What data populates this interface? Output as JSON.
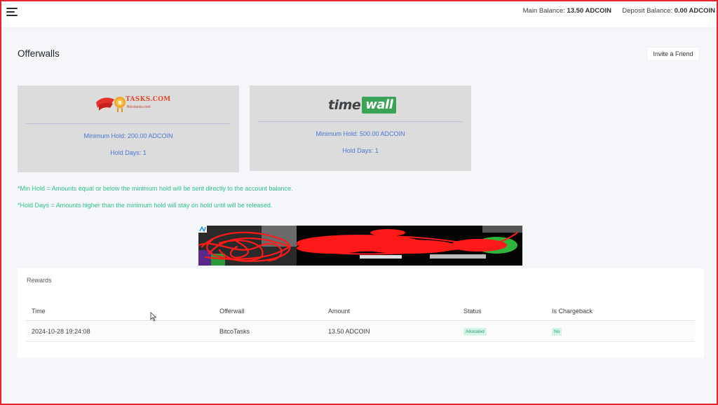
{
  "header": {
    "main_balance_label": "Main Balance:",
    "main_balance_value": "13.50 ADCOIN",
    "deposit_balance_label": "Deposit Balance:",
    "deposit_balance_value": "0.00 ADCOIN"
  },
  "page": {
    "title": "Offerwalls",
    "invite_button": "Invite a Friend"
  },
  "offerwalls": [
    {
      "logo_text": "TASKS.COM",
      "logo_subtext": "Bitcotasks.com",
      "min_hold": "Minimum Hold: 200.00 ADCOIN",
      "hold_days": "Hold Days: 1"
    },
    {
      "logo_text_1": "time",
      "logo_text_2": "wall",
      "min_hold": "Minimum Hold: 500.00 ADCOIN",
      "hold_days": "Hold Days: 1"
    }
  ],
  "notes": [
    "*Min Hold = Amounts equal or below the minimum hold will be sent directly to the account balance.",
    "*Hold Days = Amounts higher than the minimum hold will stay on hold until will be released."
  ],
  "rewards": {
    "title": "Rewards",
    "columns": [
      "Time",
      "Offerwall",
      "Amount",
      "Status",
      "Is Chargeback"
    ],
    "rows": [
      {
        "time": "2024-10-28 19:24:08",
        "offerwall": "BitcoTasks",
        "amount": "13.50 ADCOIN",
        "status": "Allocated",
        "chargeback": "No"
      }
    ]
  },
  "colors": {
    "accent_blue": "#4a76d0",
    "note_green": "#2fbf8a",
    "badge_green_bg": "#d4f4e5",
    "frame_red": "#e3262b"
  },
  "icons": {
    "menu": "hamburger-icon",
    "cursor": "mouse-pointer-icon"
  }
}
